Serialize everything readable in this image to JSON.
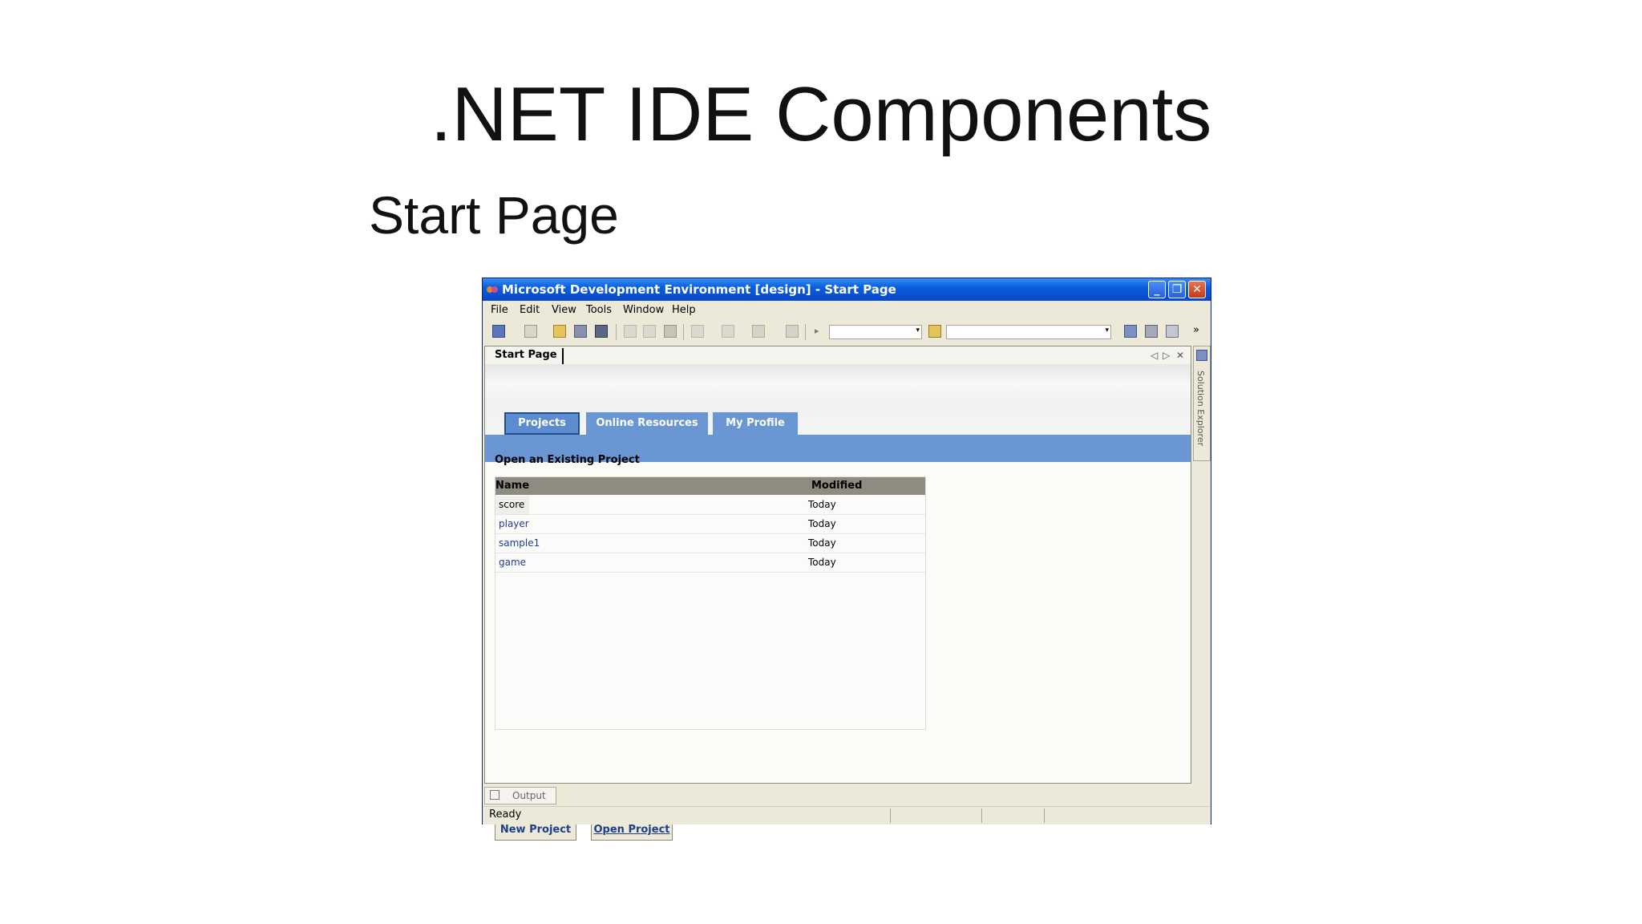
{
  "slide": {
    "title": ".NET IDE Components",
    "subtitle": "Start Page"
  },
  "window": {
    "title": "Microsoft Development Environment [design] - Start Page",
    "controls": {
      "minimize": "_",
      "restore": "❐",
      "close": "✕"
    }
  },
  "menu": {
    "items": [
      {
        "label": "File"
      },
      {
        "label": "Edit"
      },
      {
        "label": "View"
      },
      {
        "label": "Tools"
      },
      {
        "label": "Window"
      },
      {
        "label": "Help"
      }
    ]
  },
  "toolbar": {
    "overflow": "»",
    "combo_arrow": "▾"
  },
  "document": {
    "tab_label": "Start Page",
    "nav_prev": "◁",
    "nav_next": "▷",
    "nav_close": "✕"
  },
  "start_page": {
    "tabs": [
      {
        "label": "Projects"
      },
      {
        "label": "Online Resources"
      },
      {
        "label": "My Profile"
      }
    ],
    "section_title": "Open an Existing Project",
    "table": {
      "headers": {
        "name": "Name",
        "modified": "Modified"
      },
      "rows": [
        {
          "name": "score",
          "modified": "Today"
        },
        {
          "name": "player",
          "modified": "Today"
        },
        {
          "name": "sample1",
          "modified": "Today"
        },
        {
          "name": "game",
          "modified": "Today"
        }
      ]
    },
    "buttons": {
      "new_project": "New Project",
      "open_project": "Open Project"
    }
  },
  "side_panel": {
    "label": "Solution Explorer"
  },
  "output": {
    "label": "Output"
  },
  "status": {
    "text": "Ready"
  }
}
